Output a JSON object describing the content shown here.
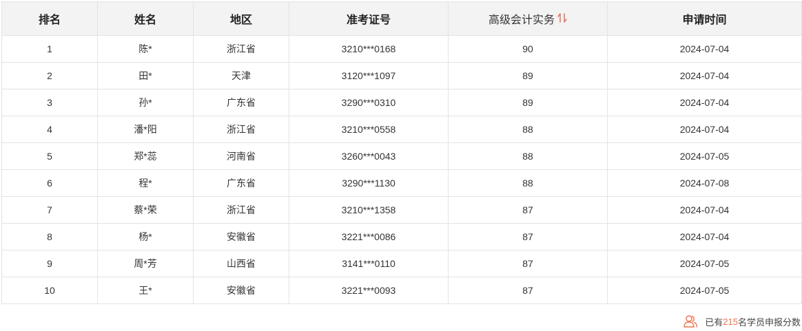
{
  "table": {
    "headers": {
      "rank": "排名",
      "name": "姓名",
      "region": "地区",
      "ticket": "准考证号",
      "score": "高级会计实务",
      "date": "申请时间"
    },
    "rows": [
      {
        "rank": "1",
        "name": "陈*",
        "region": "浙江省",
        "ticket": "3210***0168",
        "score": "90",
        "date": "2024-07-04"
      },
      {
        "rank": "2",
        "name": "田*",
        "region": "天津",
        "ticket": "3120***1097",
        "score": "89",
        "date": "2024-07-04"
      },
      {
        "rank": "3",
        "name": "孙*",
        "region": "广东省",
        "ticket": "3290***0310",
        "score": "89",
        "date": "2024-07-04"
      },
      {
        "rank": "4",
        "name": "潘*阳",
        "region": "浙江省",
        "ticket": "3210***0558",
        "score": "88",
        "date": "2024-07-04"
      },
      {
        "rank": "5",
        "name": "郑*蕊",
        "region": "河南省",
        "ticket": "3260***0043",
        "score": "88",
        "date": "2024-07-05"
      },
      {
        "rank": "6",
        "name": "程*",
        "region": "广东省",
        "ticket": "3290***1130",
        "score": "88",
        "date": "2024-07-08"
      },
      {
        "rank": "7",
        "name": "蔡*荣",
        "region": "浙江省",
        "ticket": "3210***1358",
        "score": "87",
        "date": "2024-07-04"
      },
      {
        "rank": "8",
        "name": "杨*",
        "region": "安徽省",
        "ticket": "3221***0086",
        "score": "87",
        "date": "2024-07-04"
      },
      {
        "rank": "9",
        "name": "周*芳",
        "region": "山西省",
        "ticket": "3141***0110",
        "score": "87",
        "date": "2024-07-05"
      },
      {
        "rank": "10",
        "name": "王*",
        "region": "安徽省",
        "ticket": "3221***0093",
        "score": "87",
        "date": "2024-07-05"
      }
    ]
  },
  "footer": {
    "prefix": "已有",
    "count": "215",
    "suffix": "名学员申报分数"
  },
  "icons": {
    "sort": "sort-arrows-icon",
    "people": "people-icon"
  },
  "colors": {
    "accent": "#f07048",
    "header_bg": "#f3f3f3",
    "border": "#e3e3e3"
  }
}
